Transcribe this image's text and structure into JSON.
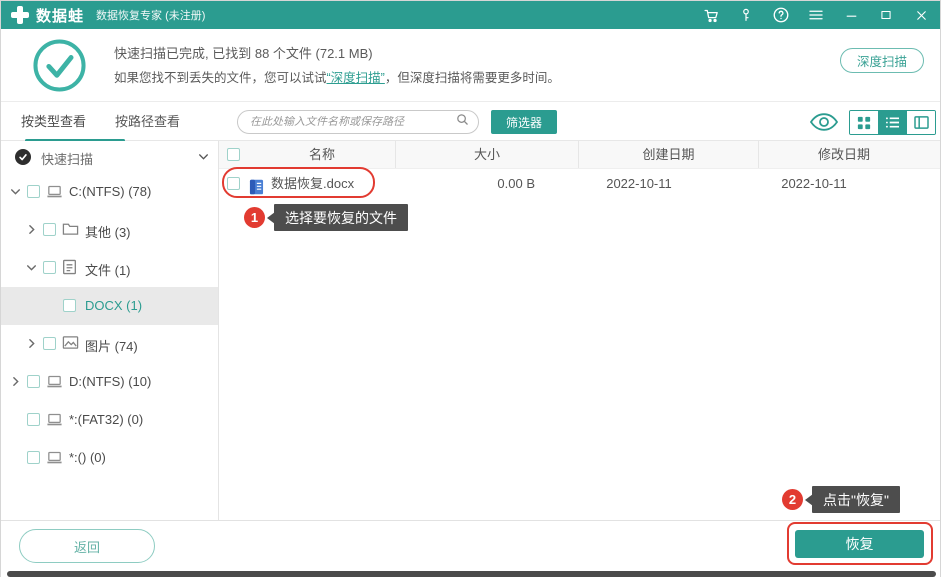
{
  "titlebar": {
    "brand": "数据蛙",
    "subtitle": "数据恢复专家 (未注册)"
  },
  "banner": {
    "line1": "快速扫描已完成, 已找到 88 个文件 (72.1 MB)",
    "line2_pre": "如果您找不到丢失的文件，您可以试试",
    "line2_link": "“深度扫描”",
    "line2_post": "，但深度扫描将需要更多时间。",
    "deep_scan_button": "深度扫描"
  },
  "toolbar": {
    "tab_by_type": "按类型查看",
    "tab_by_path": "按路径查看",
    "search_placeholder": "在此处输入文件名称或保存路径",
    "filter_button": "筛选器"
  },
  "sidebar": {
    "scan_mode": "快速扫描",
    "tree": [
      {
        "label": "C:(NTFS) (78)",
        "level": 0,
        "expanded": true,
        "icon": "drive"
      },
      {
        "label": "其他 (3)",
        "level": 1,
        "expanded": false,
        "icon": "folder"
      },
      {
        "label": "文件 (1)",
        "level": 1,
        "expanded": true,
        "icon": "document"
      },
      {
        "label": "DOCX (1)",
        "level": 2,
        "selected": true,
        "icon": "none"
      },
      {
        "label": "图片 (74)",
        "level": 1,
        "expanded": false,
        "icon": "image"
      },
      {
        "label": "D:(NTFS) (10)",
        "level": 0,
        "expanded": false,
        "icon": "drive"
      },
      {
        "label": "*:(FAT32) (0)",
        "level": 0,
        "icon": "drive"
      },
      {
        "label": "*:() (0)",
        "level": 0,
        "icon": "drive"
      }
    ]
  },
  "table": {
    "columns": [
      "名称",
      "大小",
      "创建日期",
      "修改日期"
    ],
    "rows": [
      {
        "name": "数据恢复.docx",
        "size": "0.00 B",
        "created": "2022-10-11",
        "modified": "2022-10-11"
      }
    ]
  },
  "annotations": {
    "step1": {
      "number": "1",
      "text": "选择要恢复的文件"
    },
    "step2": {
      "number": "2",
      "text": "点击\"恢复\""
    }
  },
  "footer": {
    "back_button": "返回",
    "recover_button": "恢复"
  },
  "icons": {
    "titlebar": [
      "cart-icon",
      "key-icon",
      "help-icon",
      "menu-icon",
      "minimize-icon",
      "maximize-icon",
      "close-icon"
    ],
    "toolbar": [
      "search-icon",
      "eye-icon",
      "grid-view-icon",
      "list-view-icon",
      "column-view-icon"
    ],
    "status": "check-circle-icon"
  },
  "colors": {
    "accent": "#2b9c90",
    "annotation_red": "#e23b31",
    "tooltip_bg": "#4d4d4d",
    "selected_row_bg": "#e9e9e9"
  }
}
